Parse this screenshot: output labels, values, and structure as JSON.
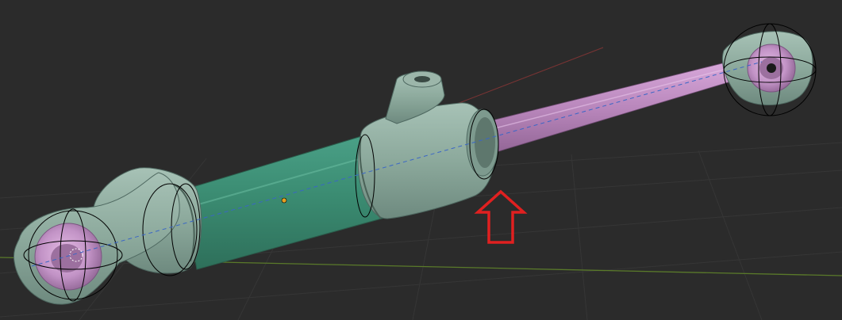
{
  "app": {
    "view": "3d-viewport"
  },
  "colors": {
    "background": "#2b2b2b",
    "grid_line": "#393939",
    "axis_x": "#8a3a3a",
    "axis_y": "#5a7a2a",
    "cylinder_body": "#3f8f78",
    "end_caps": "#8aa89c",
    "piston_rod": "#c08ac4",
    "bushing": "#c69ac8",
    "selection_outline": "#000000",
    "center_axis_dashed": "#3a66c6",
    "annotation_arrow": "#e02020",
    "origin_point": "#e6a020"
  },
  "objects": [
    {
      "name": "cylinder-barrel",
      "selected": true
    },
    {
      "name": "rear-cap",
      "selected": true
    },
    {
      "name": "front-gland",
      "selected": true
    },
    {
      "name": "piston-rod",
      "selected": true
    },
    {
      "name": "rod-eye",
      "selected": true
    },
    {
      "name": "rear-clevis",
      "selected": true
    }
  ],
  "annotation": {
    "type": "up-arrow",
    "pointing_to": "front-gland"
  }
}
